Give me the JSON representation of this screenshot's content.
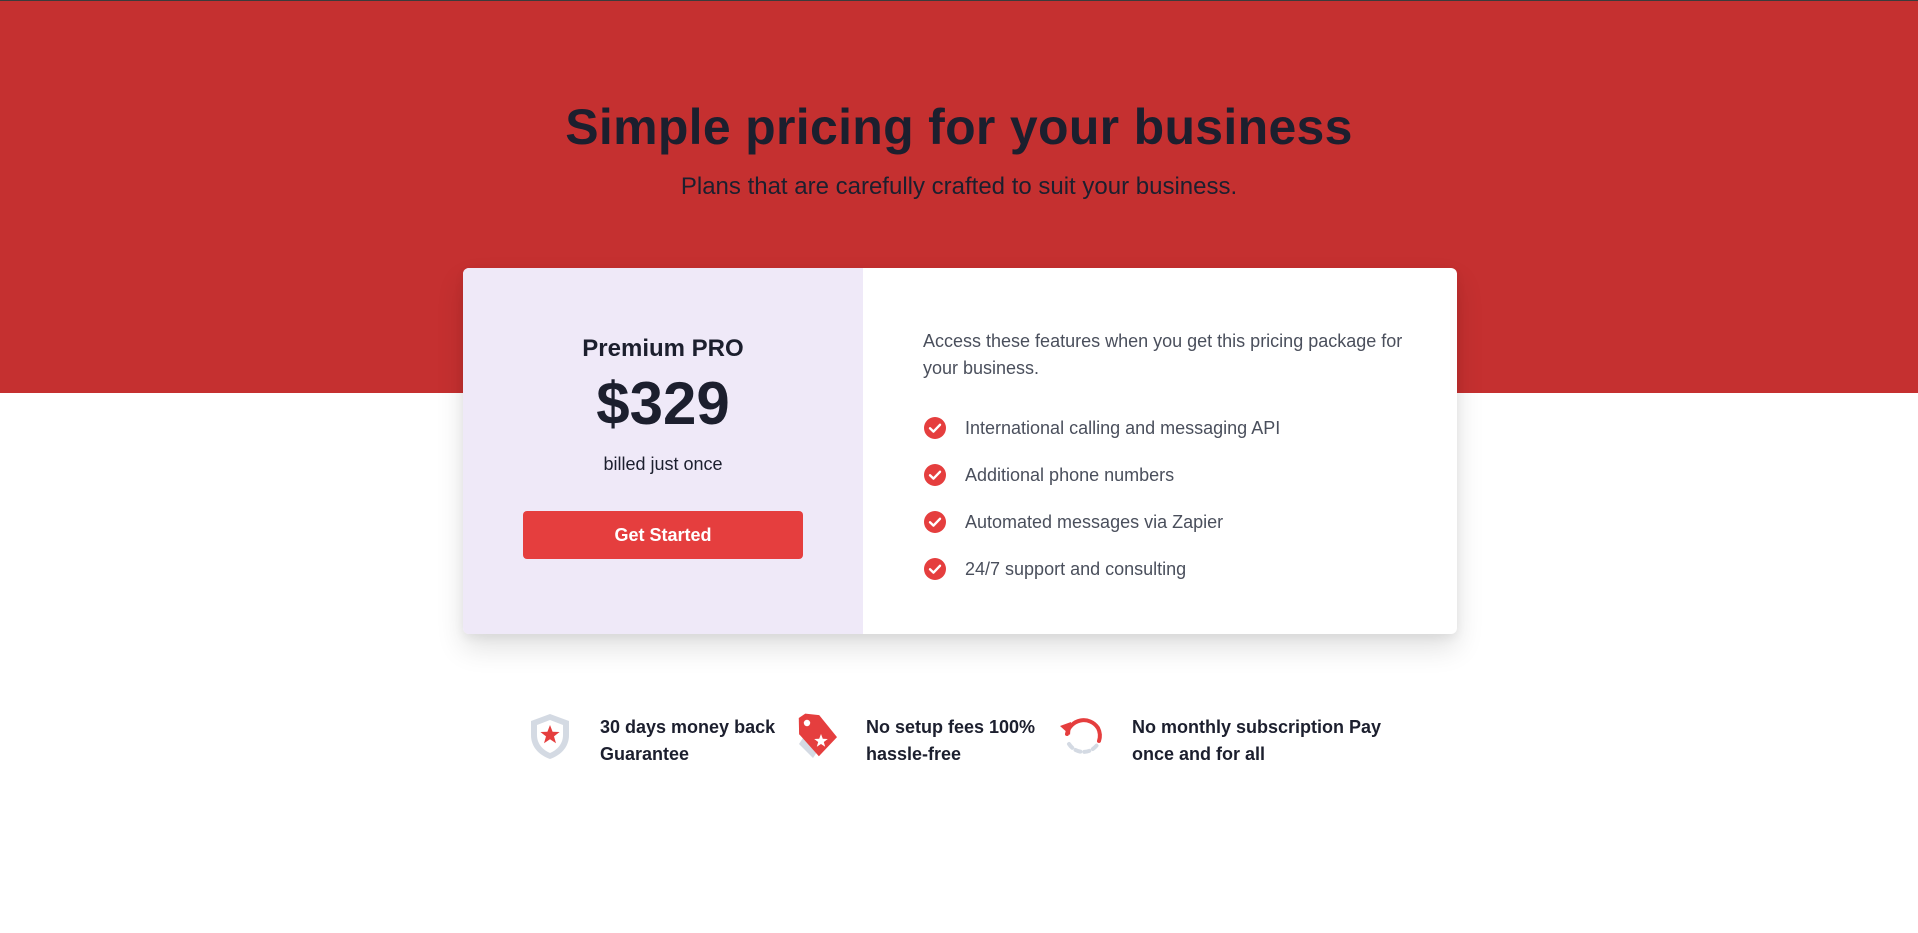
{
  "hero": {
    "title": "Simple pricing for your business",
    "subtitle": "Plans that are carefully crafted to suit your business."
  },
  "plan": {
    "name": "Premium PRO",
    "price": "$329",
    "billing": "billed just once",
    "cta_label": "Get Started"
  },
  "features": {
    "intro": "Access these features when you get this pricing package for your business.",
    "items": [
      {
        "label": "International calling and messaging API",
        "icon": "check-circle-icon"
      },
      {
        "label": "Additional phone numbers",
        "icon": "check-circle-icon"
      },
      {
        "label": "Automated messages via Zapier",
        "icon": "check-circle-icon"
      },
      {
        "label": "24/7 support and consulting",
        "icon": "check-circle-icon"
      }
    ]
  },
  "guarantees": [
    {
      "line1": "30 days money back",
      "line2": "Guarantee",
      "icon": "shield-star-icon"
    },
    {
      "line1": "No setup fees 100%",
      "line2": "hassle-free",
      "icon": "price-tag-icon"
    },
    {
      "line1": "No monthly subscription Pay",
      "line2": "once and for all",
      "icon": "refresh-icon"
    }
  ],
  "colors": {
    "hero_bg": "#c53030",
    "accent": "#e53e3e",
    "plan_panel_bg": "#efe9f8",
    "heading_text": "#1c1f2e",
    "body_text": "#4a4f5c"
  }
}
